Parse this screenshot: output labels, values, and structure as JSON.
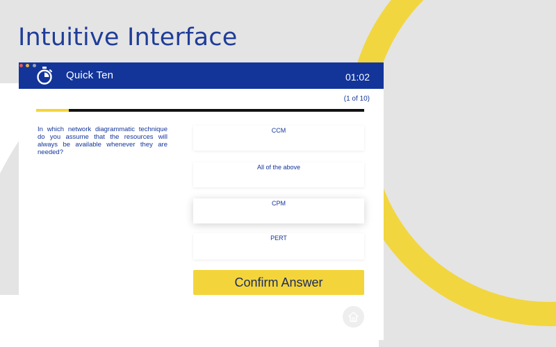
{
  "headline": "Intuitive Interface",
  "app": {
    "title": "Quick Ten",
    "timer": "01:02",
    "counter": "(1 of 10)",
    "progress": 0.1
  },
  "question": {
    "text": "In which network diagrammatic technique do you assume that the resources will always be available whenever they are needed?"
  },
  "options": [
    {
      "label": "CCM"
    },
    {
      "label": "All of the above"
    },
    {
      "label": "CPM"
    },
    {
      "label": "PERT"
    }
  ],
  "confirm_label": "Confirm Answer",
  "icons": {
    "timer": "stopwatch-icon",
    "home": "home-icon"
  },
  "colors": {
    "brand_blue": "#13359a",
    "accent_yellow": "#f3d53b",
    "background_gray": "#e4e4e4"
  }
}
